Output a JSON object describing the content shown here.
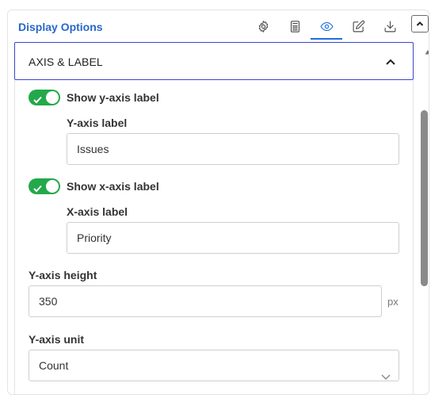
{
  "header": {
    "title": "Display Options",
    "tools": [
      {
        "name": "settings",
        "icon": "gear-icon"
      },
      {
        "name": "calculator",
        "icon": "calculator-icon"
      },
      {
        "name": "display",
        "icon": "eye-icon",
        "active": true
      },
      {
        "name": "edit",
        "icon": "edit-icon"
      },
      {
        "name": "download",
        "icon": "download-icon"
      }
    ],
    "collapse_icon": "chevron-up-icon"
  },
  "section": {
    "title": "AXIS & LABEL",
    "expanded": true
  },
  "y_label_toggle": {
    "label": "Show y-axis label",
    "enabled": true,
    "field_label": "Y-axis label",
    "value": "Issues"
  },
  "x_label_toggle": {
    "label": "Show x-axis label",
    "enabled": true,
    "field_label": "X-axis label",
    "value": "Priority"
  },
  "y_axis_height": {
    "label": "Y-axis height",
    "value": "350",
    "unit": "px"
  },
  "y_axis_unit": {
    "label": "Y-axis unit",
    "selected": "Count"
  },
  "colors": {
    "accent": "#1f6fd8",
    "toggle_on": "#23a84b",
    "section_border": "#3a45c8"
  }
}
